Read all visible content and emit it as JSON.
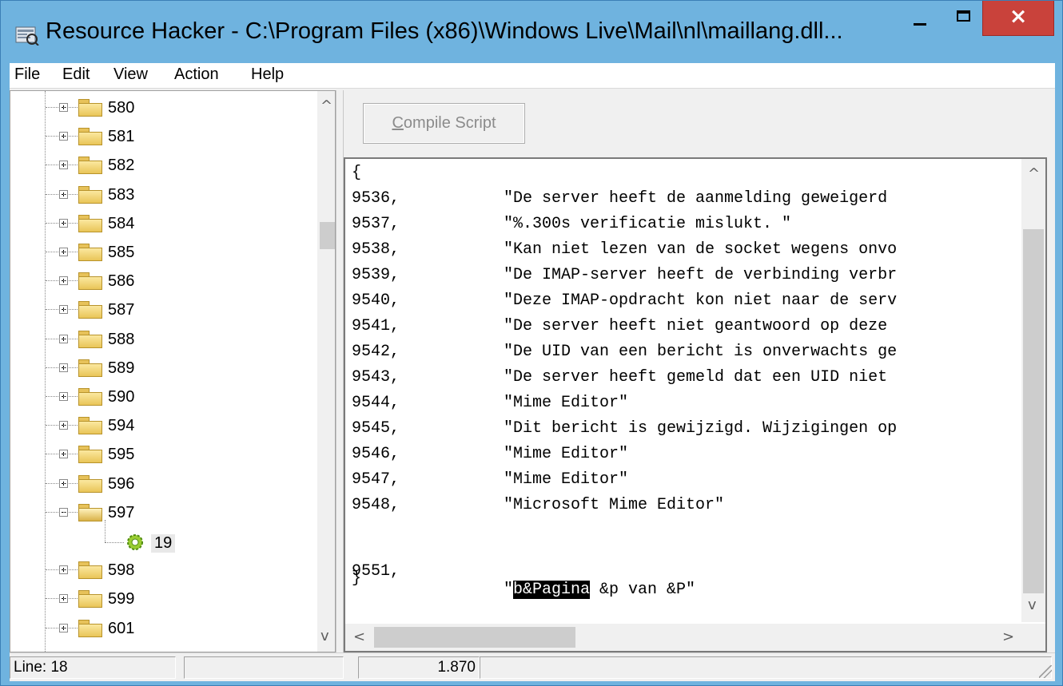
{
  "window": {
    "title": "Resource Hacker  -  C:\\Program Files (x86)\\Windows Live\\Mail\\nl\\maillang.dll...",
    "minimize_icon": "minimize-icon",
    "maximize_icon": "maximize-icon",
    "close_label": "×",
    "accent_color": "#6fb3df",
    "close_color": "#c9423b"
  },
  "menu": [
    "File",
    "Edit",
    "View",
    "Action",
    "Help"
  ],
  "tree": {
    "items": [
      {
        "label": "580",
        "state": "collapsed"
      },
      {
        "label": "581",
        "state": "collapsed"
      },
      {
        "label": "582",
        "state": "collapsed"
      },
      {
        "label": "583",
        "state": "collapsed"
      },
      {
        "label": "584",
        "state": "collapsed"
      },
      {
        "label": "585",
        "state": "collapsed"
      },
      {
        "label": "586",
        "state": "collapsed"
      },
      {
        "label": "587",
        "state": "collapsed"
      },
      {
        "label": "588",
        "state": "collapsed"
      },
      {
        "label": "589",
        "state": "collapsed"
      },
      {
        "label": "590",
        "state": "collapsed"
      },
      {
        "label": "594",
        "state": "collapsed"
      },
      {
        "label": "595",
        "state": "collapsed"
      },
      {
        "label": "596",
        "state": "collapsed"
      },
      {
        "label": "597",
        "state": "expanded"
      },
      {
        "label": "19",
        "state": "child"
      },
      {
        "label": "598",
        "state": "collapsed"
      },
      {
        "label": "599",
        "state": "collapsed"
      },
      {
        "label": "601",
        "state": "collapsed"
      }
    ]
  },
  "toolbar": {
    "compile_prefix": "C",
    "compile_rest": "ompile Script"
  },
  "editor": {
    "open_brace": "{",
    "close_brace": "}",
    "lines": [
      {
        "num": "9536,",
        "text": "\"De server heeft de aanmelding geweigerd"
      },
      {
        "num": "9537,",
        "text": "\"%.300s verificatie mislukt. \""
      },
      {
        "num": "9538,",
        "text": "\"Kan niet lezen van de socket wegens onvo"
      },
      {
        "num": "9539,",
        "text": "\"De IMAP-server heeft de verbinding verbr"
      },
      {
        "num": "9540,",
        "text": "\"Deze IMAP-opdracht kon niet naar de serv"
      },
      {
        "num": "9541,",
        "text": "\"De server heeft niet geantwoord op deze"
      },
      {
        "num": "9542,",
        "text": "\"De UID van een bericht is onverwachts ge"
      },
      {
        "num": "9543,",
        "text": "\"De server heeft gemeld dat een UID niet"
      },
      {
        "num": "9544,",
        "text": "\"Mime Editor\""
      },
      {
        "num": "9545,",
        "text": "\"Dit bericht is gewijzigd. Wijzigingen op"
      },
      {
        "num": "9546,",
        "text": "\"Mime Editor\""
      },
      {
        "num": "9547,",
        "text": "\"Mime Editor\""
      },
      {
        "num": "9548,",
        "text": "\"Microsoft Mime Editor\""
      }
    ],
    "last_line": {
      "num": "9551,",
      "quote": "\"",
      "selected": "b&Pagina",
      "rest": " &p van &P\""
    }
  },
  "status": {
    "line": "Line: 18",
    "panel2": "",
    "offset": "1.870",
    "panel4": ""
  }
}
